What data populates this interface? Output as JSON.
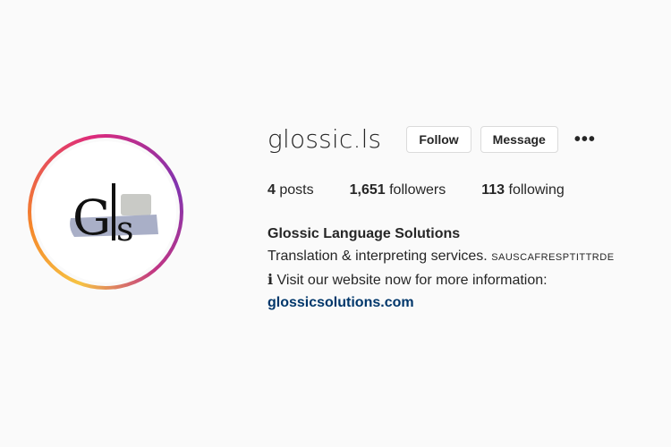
{
  "profile": {
    "username": "glossic.ls",
    "follow_label": "Follow",
    "message_label": "Message",
    "more_label": "•••"
  },
  "stats": {
    "posts_count": "4",
    "posts_label": "posts",
    "followers_count": "1,651",
    "followers_label": "followers",
    "following_count": "113",
    "following_label": "following"
  },
  "bio": {
    "name": "Glossic Language Solutions",
    "line1": "Translation & interpreting services.",
    "flags": "SAUSCAFRESPTITTRDE",
    "info_icon": "ℹ",
    "line2": "Visit our website now for more information:",
    "link": "glossicsolutions.com"
  },
  "colors": {
    "link": "#00376b",
    "ring_start": "#f6c343",
    "ring_end": "#8134af"
  }
}
